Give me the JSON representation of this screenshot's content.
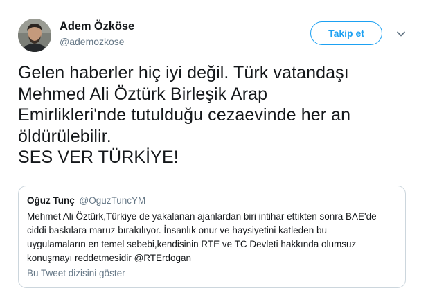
{
  "author": {
    "name": "Adem Özköse",
    "handle": "@ademozkose"
  },
  "follow_button": {
    "label": "Takip et"
  },
  "menu": {
    "icon": "chevron-down-icon"
  },
  "tweet": {
    "lines": [
      "Gelen haberler hiç iyi değil. Türk vatandaşı",
      "Mehmed Ali Öztürk Birleşik Arap",
      "Emirlikleri'nde tutulduğu cezaevinde her an",
      "öldürülebilir.",
      "SES VER TÜRKİYE!"
    ]
  },
  "quoted_tweet": {
    "name": "Oğuz Tunç",
    "handle": "@OguzTuncYM",
    "lines": [
      "Mehmet Ali Öztürk,Türkiye de yakalanan ajanlardan biri intihar ettikten sonra BAE'de",
      "ciddi baskılara maruz bırakılıyor. İnsanlık onur ve haysiyetini katleden bu",
      "uygulamaların en temel sebebi,kendisinin RTE ve TC Devleti hakkında olumsuz",
      "konuşmayı reddetmesidir @RTErdogan"
    ],
    "thread_link": "Bu Tweet dizisini göster"
  },
  "colors": {
    "accent": "#1da1f2",
    "text": "#14171a",
    "muted": "#657786",
    "border": "#ccd6dd"
  }
}
